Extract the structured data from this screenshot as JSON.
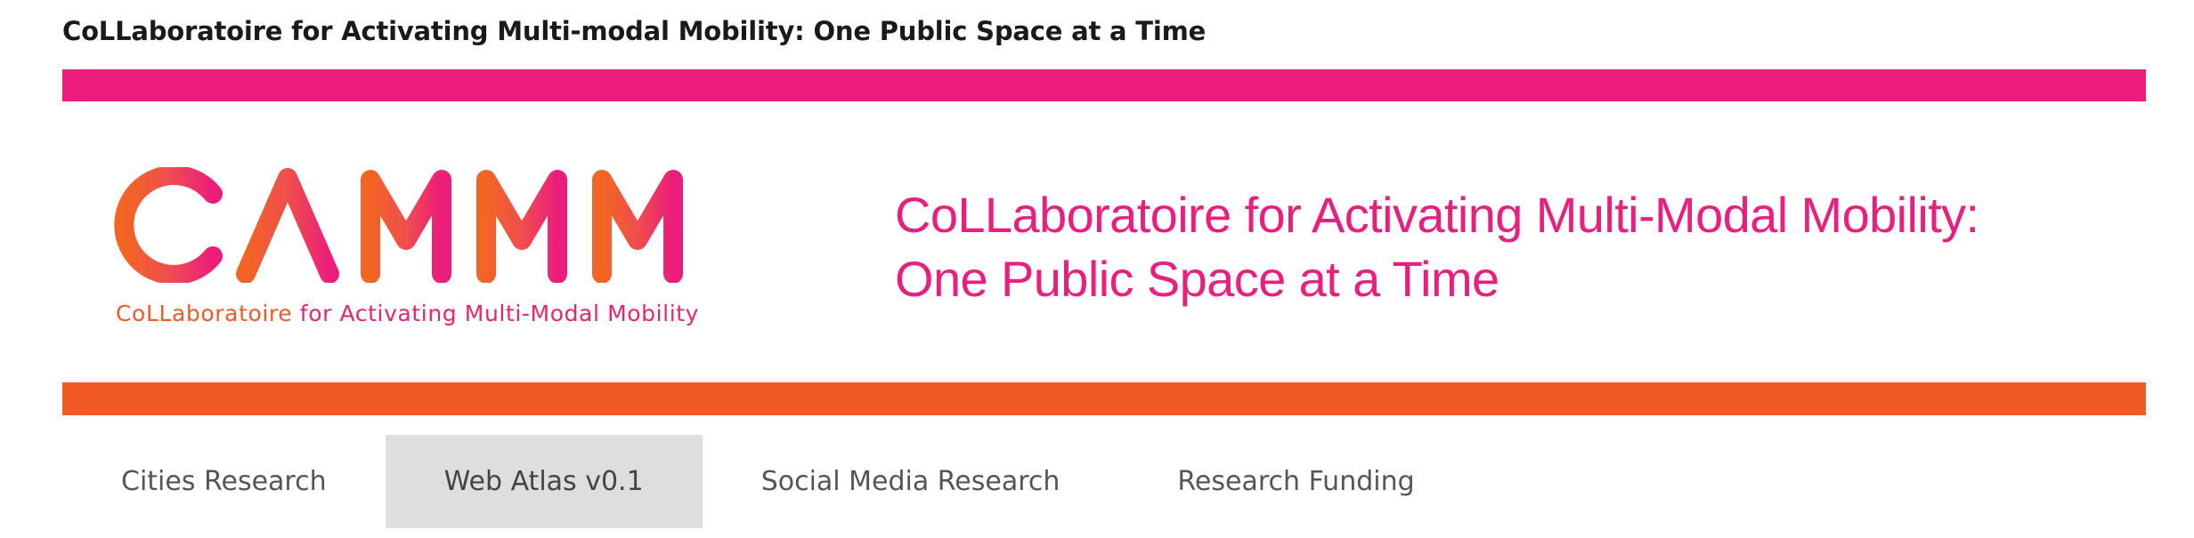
{
  "header": {
    "site_title": "CoLLaboratoire for Activating Multi-modal Mobility: One Public Space at a Time"
  },
  "banner": {
    "logo": {
      "letters": "CAMMM",
      "subtitle_part1": "CoLLaboratoire",
      "subtitle_part2": " for Activating Multi-Modal Mobility"
    },
    "tagline_line1": "CoLLaboratoire for Activating Multi-Modal Mobility:",
    "tagline_line2": "One Public Space at a Time"
  },
  "nav": {
    "items": [
      {
        "label": "Cities Research"
      },
      {
        "label": "Web Atlas v0.1",
        "active": true
      },
      {
        "label": "Social Media Research"
      },
      {
        "label": "Research Funding"
      }
    ]
  },
  "colors": {
    "pink": "#ec1c7a",
    "orange": "#f15a24",
    "nav_active_bg": "#dedede"
  }
}
